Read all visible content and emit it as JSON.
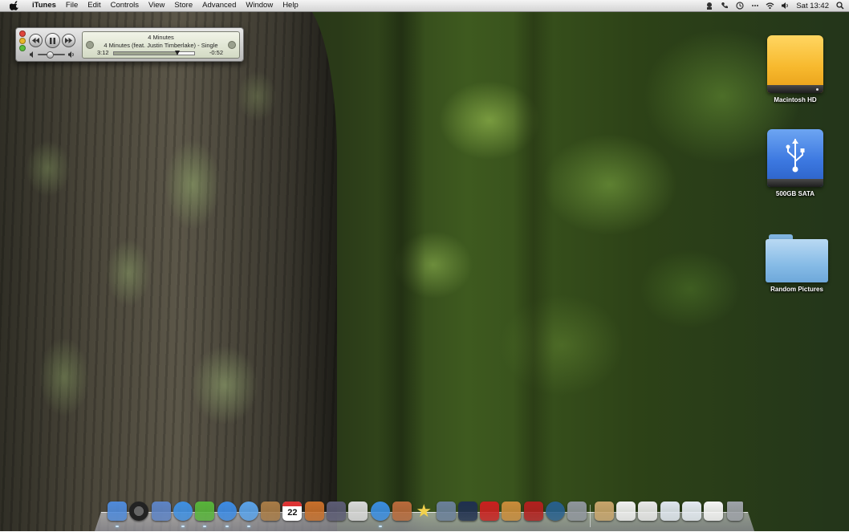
{
  "menubar": {
    "app_name": "iTunes",
    "menus": [
      "File",
      "Edit",
      "Controls",
      "View",
      "Store",
      "Advanced",
      "Window",
      "Help"
    ],
    "clock": "Sat 13:42",
    "status_icons": [
      "messenger-icon",
      "phone-icon",
      "time-machine-icon",
      "sync-icon",
      "wifi-icon",
      "volume-icon",
      "spotlight-icon"
    ]
  },
  "mini_player": {
    "song_title": "4 Minutes",
    "song_detail": "4 Minutes (feat. Justin Timberlake) - Single",
    "elapsed": "3:12",
    "remaining": "-0:52",
    "progress": 0.79,
    "volume": 0.4
  },
  "desktop_icons": [
    {
      "label": "Macintosh HD",
      "icon": "hard-drive-icon"
    },
    {
      "label": "500GB SATA",
      "icon": "usb-drive-icon"
    },
    {
      "label": "Random Pictures",
      "icon": "folder-icon"
    }
  ],
  "dock": {
    "calendar_day": "22",
    "items": [
      {
        "name": "finder",
        "color": "#4f8ad9"
      },
      {
        "name": "dashboard",
        "color": "#2c2c2c"
      },
      {
        "name": "preview",
        "color": "#5d83c4"
      },
      {
        "name": "safari",
        "color": "#3f8fe0"
      },
      {
        "name": "adium",
        "color": "#57b33a"
      },
      {
        "name": "ichat",
        "color": "#3d8be3"
      },
      {
        "name": "messages",
        "color": "#5aa2e8"
      },
      {
        "name": "address-book",
        "color": "#a77b46"
      },
      {
        "name": "ical",
        "color": "#f2f2f2"
      },
      {
        "name": "keynote",
        "color": "#c76f2a"
      },
      {
        "name": "pencil-app",
        "color": "#5b5b73"
      },
      {
        "name": "stocks",
        "color": "#d9d9d9"
      },
      {
        "name": "itunes",
        "color": "#3a8de0"
      },
      {
        "name": "iphoto",
        "color": "#b86a3b"
      },
      {
        "name": "imovie-star",
        "color": "#f0d050"
      },
      {
        "name": "spaces",
        "color": "#6a7f99"
      },
      {
        "name": "ipad-simulator",
        "color": "#1f2f4f"
      },
      {
        "name": "front-row",
        "color": "#c9201f"
      },
      {
        "name": "garageband",
        "color": "#c98b3a"
      },
      {
        "name": "photo-booth",
        "color": "#b2201e"
      },
      {
        "name": "time-machine",
        "color": "#275f8c"
      },
      {
        "name": "system-preferences",
        "color": "#8f959c"
      },
      {
        "name": "documents-stack",
        "color": "#c7a46b"
      },
      {
        "name": "text-file",
        "color": "#f0f0f0"
      },
      {
        "name": "pages-doc",
        "color": "#e9e9e9"
      },
      {
        "name": "screenshot-1",
        "color": "#dfe6ee"
      },
      {
        "name": "screenshot-2",
        "color": "#e5ebf2"
      },
      {
        "name": "notes-stack",
        "color": "#f5f5f5"
      },
      {
        "name": "trash",
        "color": "#9ea2a8"
      }
    ]
  }
}
